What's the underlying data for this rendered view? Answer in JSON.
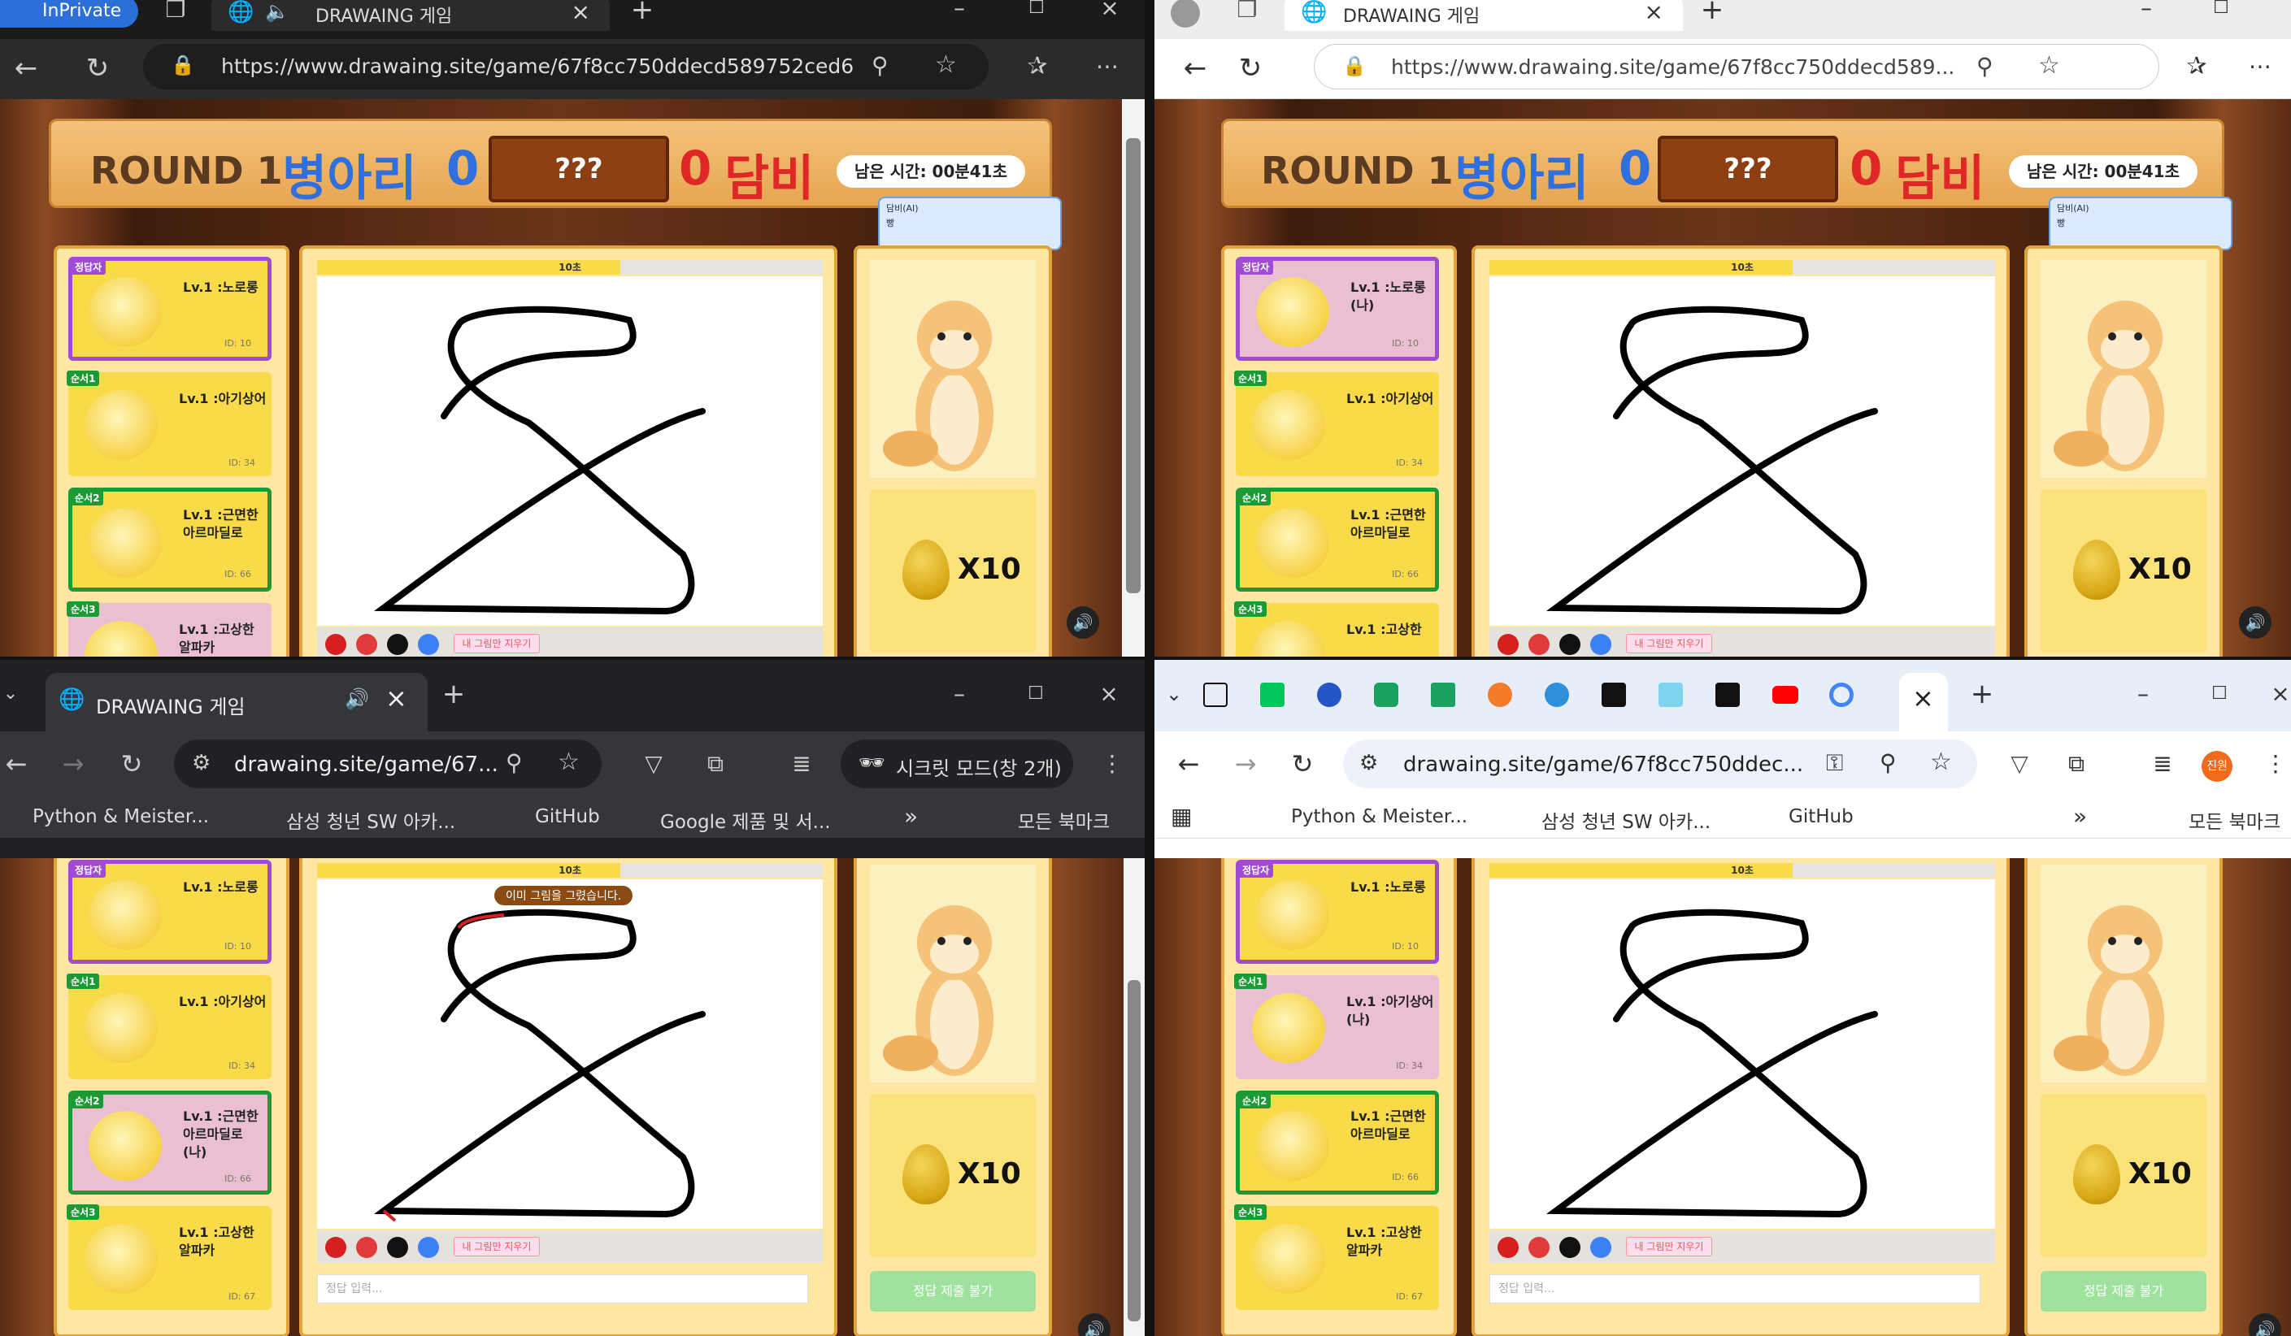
{
  "windows": {
    "tl": {
      "private_badge": "InPrivate",
      "tab_title": "DRAWAING 게임",
      "url": "https://www.drawaing.site/game/67f8cc750ddecd589752ced6"
    },
    "tr": {
      "tab_title": "DRAWAING 게임",
      "url": "https://www.drawaing.site/game/67f8cc750ddecd589..."
    },
    "bl": {
      "tab_title": "DRAWAING 게임",
      "url": "drawaing.site/game/67...",
      "incognito": "시크릿 모드(창 2개)",
      "bookmarks": [
        "Python & Meister...",
        "삼성 청년 SW 아카...",
        "GitHub",
        "Google 제품 및 서..."
      ],
      "all_bookmarks": "모든 북마크"
    },
    "br": {
      "url": "drawaing.site/game/67f8cc750ddec...",
      "avatar": "진원",
      "bookmarks": [
        "Python & Meister...",
        "삼성 청년 SW 아카...",
        "GitHub"
      ],
      "all_bookmarks": "모든 북마크"
    }
  },
  "game": {
    "round_label": "ROUND 1",
    "team_blue": "병아리",
    "team_blue_score": "0",
    "word": "???",
    "team_red_score": "0",
    "team_red": "담비",
    "time_left": "남은 시간: 00분41초",
    "timer_label": "10초",
    "timer_fraction": 0.6,
    "ai_bubble_name": "담비(AI)",
    "ai_bubble_text": "빵",
    "egg_count": "X10",
    "clear_button": "내 그림만 지우기",
    "answer_placeholder": "정답 입력...",
    "submit_disabled": "정답 제출 불가",
    "already_drew": "이미 그림을 그렸습니다."
  },
  "players_view": [
    {
      "tag": "정답자",
      "name": "Lv.1 :노로롱",
      "id": "ID: 10"
    },
    {
      "tag": "순서1",
      "name": "Lv.1 :아기상어",
      "id": "ID: 34"
    },
    {
      "tag": "순서2",
      "name": "Lv.1 :근면한 아르마딜로",
      "id": "ID: 66"
    },
    {
      "tag": "순서3",
      "name": "Lv.1 :고상한 알파카",
      "id": "ID: 67"
    }
  ],
  "players_tr": [
    {
      "tag": "정답자",
      "name": "Lv.1 :노로롱 (나)",
      "id": "ID: 10"
    },
    {
      "tag": "순서1",
      "name": "Lv.1 :아기상어",
      "id": "ID: 34"
    },
    {
      "tag": "순서2",
      "name": "Lv.1 :근면한 아르마딜로",
      "id": "ID: 66"
    },
    {
      "tag": "순서3",
      "name": "Lv.1 :고상한",
      "id": ""
    }
  ],
  "players_bl": [
    {
      "tag": "정답자",
      "name": "Lv.1 :노로롱",
      "id": "ID: 10"
    },
    {
      "tag": "순서1",
      "name": "Lv.1 :아기상어",
      "id": "ID: 34"
    },
    {
      "tag": "순서2",
      "name": "Lv.1 :근면한 아르마딜로 (나)",
      "id": "ID: 66"
    },
    {
      "tag": "순서3",
      "name": "Lv.1 :고상한 알파카",
      "id": "ID: 67"
    }
  ],
  "players_br": [
    {
      "tag": "정답자",
      "name": "Lv.1 :노로롱",
      "id": "ID: 10"
    },
    {
      "tag": "순서1",
      "name": "Lv.1 :아기상어 (나)",
      "id": "ID: 34"
    },
    {
      "tag": "순서2",
      "name": "Lv.1 :근면한 아르마딜로",
      "id": "ID: 66"
    },
    {
      "tag": "순서3",
      "name": "Lv.1 :고상한 알파카",
      "id": "ID: 67"
    }
  ],
  "colors": {
    "blue_team": "#2f6fde",
    "red_team": "#e02727",
    "card_yellow": "#f9da49",
    "selected_purple": "#a04ad6",
    "order_green": "#1c9a36"
  }
}
